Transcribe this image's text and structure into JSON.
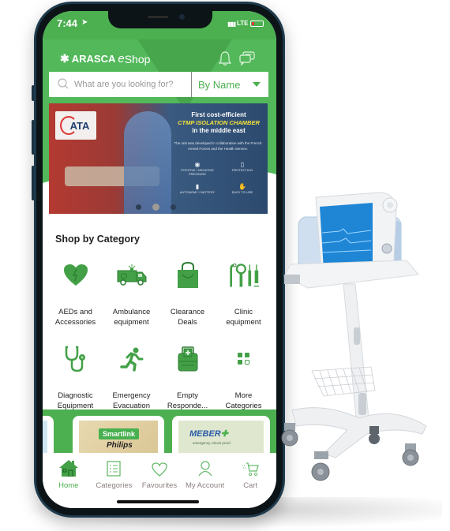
{
  "status_bar": {
    "time": "7:44",
    "network": "LTE",
    "battery_color": "#e53935"
  },
  "header": {
    "brand_main": "ARASCA",
    "brand_e": "e",
    "brand_shop": "Shop",
    "icons": [
      "bell-icon",
      "chat-icon"
    ],
    "accent_color": "#4caf50"
  },
  "search": {
    "placeholder": "What are you looking for?",
    "value": "",
    "filter_selected": "By Name"
  },
  "banner": {
    "logo_text": "ATA",
    "headline_1": "First cost-efficient",
    "headline_2": "CTMP ISOLATION CHAMBER",
    "headline_3": "in the middle east",
    "description": "The unit was developed in collaboration with the French Armed Forces and the Health Service.",
    "features": [
      {
        "icon": "pressure-icon",
        "label": "POSITIVE / NEGATIVE PRESSURE"
      },
      {
        "icon": "protection-icon",
        "label": "PROTECTION"
      },
      {
        "icon": "battery-icon",
        "label": "AUTONOMY / BATTERY"
      },
      {
        "icon": "hand-icon",
        "label": "EASY TO USE"
      }
    ],
    "slides_total": 3,
    "active_slide": 2
  },
  "categories": {
    "title": "Shop by Category",
    "items": [
      {
        "icon": "heart-defibrillator-icon",
        "label": "AEDs and Accessories"
      },
      {
        "icon": "ambulance-icon",
        "label": "Ambulance equipment"
      },
      {
        "icon": "shopping-bag-icon",
        "label": "Clearance Deals"
      },
      {
        "icon": "clinic-tools-icon",
        "label": "Clinic equipment"
      },
      {
        "icon": "stethoscope-icon",
        "label": "Diagnostic Equipment"
      },
      {
        "icon": "running-man-icon",
        "label": "Emergency Evacuation"
      },
      {
        "icon": "first-aid-bag-icon",
        "label": "Empty Responde..."
      },
      {
        "icon": "grid-icon",
        "label": "More Categories"
      }
    ]
  },
  "promos": [
    {
      "badge": "Smartlink",
      "title": "Philips"
    },
    {
      "brand": "MEBER",
      "tagline": "emergency..shock proof"
    }
  ],
  "tabbar": {
    "items": [
      {
        "icon": "home-icon",
        "label": "Home",
        "active": true
      },
      {
        "icon": "list-icon",
        "label": "Categories",
        "active": false
      },
      {
        "icon": "heart-icon",
        "label": "Favourites",
        "active": false
      },
      {
        "icon": "user-icon",
        "label": "My Account",
        "active": false
      },
      {
        "icon": "cart-icon",
        "label": "Cart",
        "active": false
      }
    ]
  }
}
